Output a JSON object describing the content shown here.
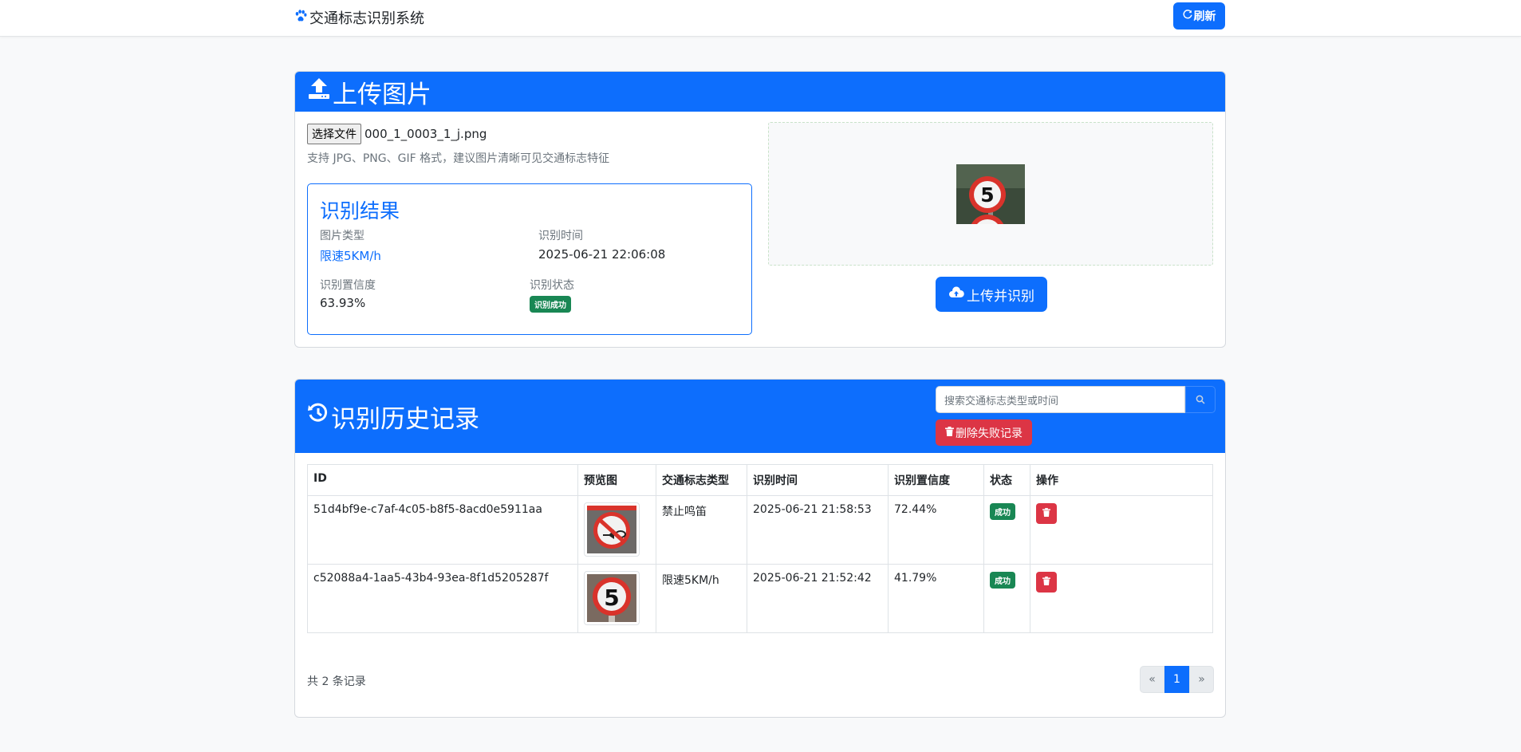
{
  "navbar": {
    "brand": "交通标志识别系统",
    "brand_icon": "paw-icon",
    "refresh_label": "刷新",
    "refresh_icon": "refresh-icon"
  },
  "upload": {
    "title": "上传图片",
    "title_icon": "upload-icon",
    "file_button": "选择文件",
    "file_name": "000_1_0003_1_j.png",
    "hint": "支持 JPG、PNG、GIF 格式，建议图片清晰可见交通标志特征",
    "submit_label": "上传并识别",
    "submit_icon": "cloud-upload-icon",
    "preview_sign": "5"
  },
  "result": {
    "title": "识别结果",
    "type_label": "图片类型",
    "type_value": "限速5KM/h",
    "time_label": "识别时间",
    "time_value": "2025-06-21 22:06:08",
    "confidence_label": "识别置信度",
    "confidence_value": "63.93%",
    "status_label": "识别状态",
    "status_value": "识别成功"
  },
  "history": {
    "title": "识别历史记录",
    "title_icon": "history-icon",
    "search_placeholder": "搜索交通标志类型或时间",
    "delete_failed_label": "删除失败记录",
    "columns": [
      "ID",
      "预览图",
      "交通标志类型",
      "识别时间",
      "识别置信度",
      "状态",
      "操作"
    ],
    "rows": [
      {
        "id": "51d4bf9e-c7af-4c05-b8f5-8acd0e5911aa",
        "type": "禁止鸣笛",
        "time": "2025-06-21 21:58:53",
        "confidence": "72.44%",
        "status": "成功"
      },
      {
        "id": "c52088a4-1aa5-43b4-93ea-8f1d5205287f",
        "type": "限速5KM/h",
        "time": "2025-06-21 21:52:42",
        "confidence": "41.79%",
        "status": "成功"
      }
    ],
    "total_text": "共 2 条记录",
    "pager": {
      "prev": "«",
      "current": "1",
      "next": "»"
    }
  },
  "colors": {
    "primary": "#0d6efd",
    "danger": "#dc3545",
    "success": "#198754"
  }
}
